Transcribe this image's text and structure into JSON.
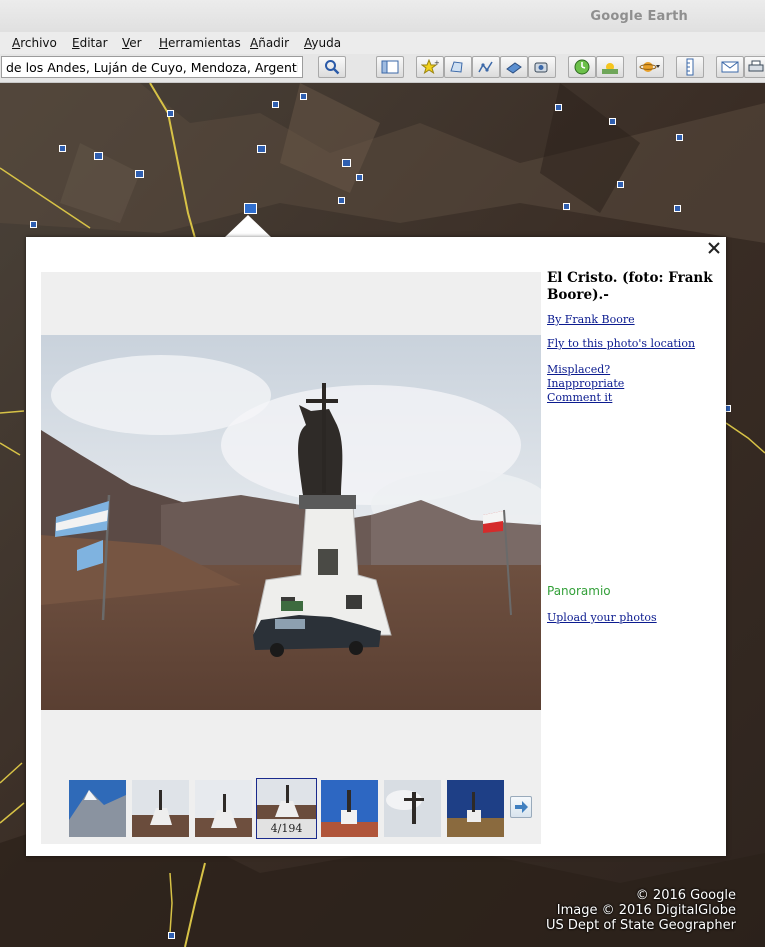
{
  "window": {
    "title": "Google Earth"
  },
  "menu": [
    "Archivo",
    "Editar",
    "Ver",
    "Herramientas",
    "Añadir",
    "Ayuda"
  ],
  "search": {
    "value": "de los Andes, Luján de Cuyo, Mendoza, Argentina"
  },
  "toolbar": {
    "icons": [
      "sidebar-toggle-icon",
      "placemark-icon",
      "polygon-icon",
      "path-icon",
      "image-overlay-icon",
      "record-tour-icon",
      "historical-imagery-icon",
      "sunlight-icon",
      "planets-icon",
      "ruler-icon",
      "email-icon",
      "print-icon"
    ]
  },
  "balloon": {
    "photo_title": "El Cristo. (foto: Frank Boore).-",
    "author_link": "By Frank Boore",
    "fly_link": "Fly to this photo's location",
    "misplaced_link": "Misplaced?",
    "inappropriate_link": "Inappropriate",
    "comment_link": "Comment it",
    "brand": "Panoramio",
    "upload_link": "Upload your photos",
    "counter": "4/194"
  },
  "attribution": {
    "line1": "© 2016 Google",
    "line2": "Image © 2016 DigitalGlobe",
    "line3": "US Dept of State Geographer"
  }
}
